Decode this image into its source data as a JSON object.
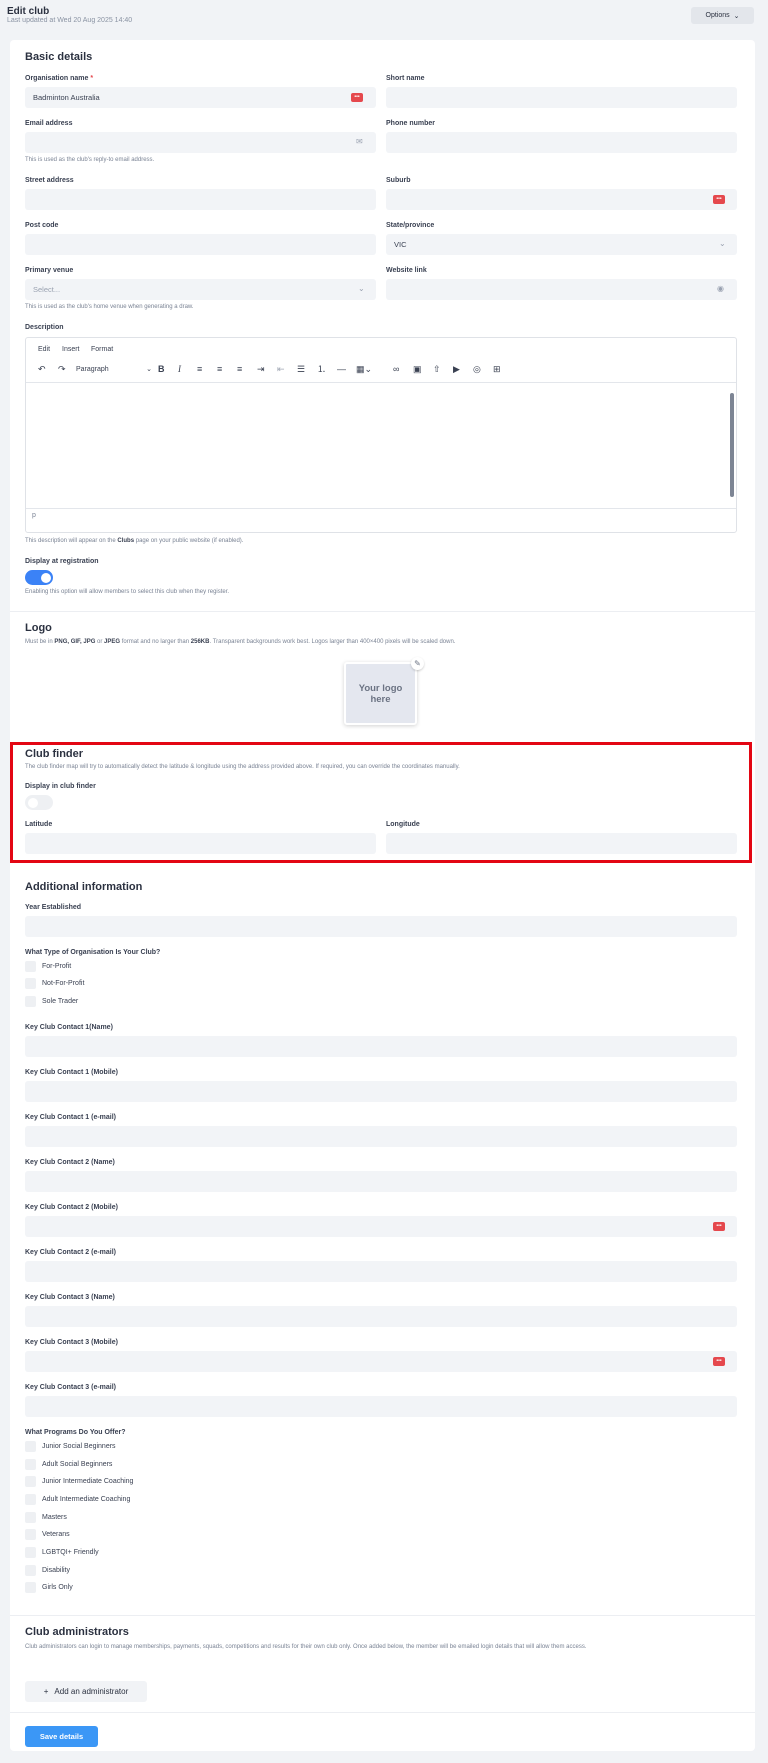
{
  "header": {
    "title": "Edit club",
    "last_updated": "Last updated at Wed 20 Aug 2025 14:40",
    "options_label": "Options"
  },
  "basic": {
    "title": "Basic details",
    "org_name_label": "Organisation name",
    "org_name_required": "*",
    "org_name_value": "Badminton Australia",
    "short_name_label": "Short name",
    "email_label": "Email address",
    "email_hint": "This is used as the club's reply-to email address.",
    "phone_label": "Phone number",
    "street_label": "Street address",
    "suburb_label": "Suburb",
    "postcode_label": "Post code",
    "state_label": "State/province",
    "state_value": "VIC",
    "venue_label": "Primary venue",
    "venue_placeholder": "Select...",
    "venue_hint": "This is used as the club's home venue when generating a draw.",
    "website_label": "Website link",
    "description_label": "Description",
    "description_hint_pre": "This description will appear on the ",
    "description_hint_bold": "Clubs",
    "description_hint_post": " page on your public website (if enabled).",
    "display_reg_label": "Display at registration",
    "display_reg_on": true,
    "display_reg_hint": "Enabling this option will allow members to select this club when they register."
  },
  "editor": {
    "menu": [
      "Edit",
      "Insert",
      "Format"
    ],
    "paragraph_label": "Paragraph",
    "status_path": "p"
  },
  "logo": {
    "title": "Logo",
    "hint_pre": "Must be in ",
    "hint_formats": "PNG, GIF, JPG",
    "hint_or": " or ",
    "hint_jpeg": "JPEG",
    "hint_mid": " format and no larger than ",
    "hint_size": "256KB",
    "hint_post": ". Transparent backgrounds work best. Logos larger than 400×400 pixels will be scaled down.",
    "placeholder_line1": "Your logo",
    "placeholder_line2": "here"
  },
  "club_finder": {
    "title": "Club finder",
    "hint": "The club finder map will try to automatically detect the latitude & longitude using the address provided above. If required, you can override the coordinates manually.",
    "display_label": "Display in club finder",
    "display_on": false,
    "latitude_label": "Latitude",
    "longitude_label": "Longitude"
  },
  "additional": {
    "title": "Additional information",
    "year_label": "Year Established",
    "org_type_label": "What Type of Organisation Is Your Club?",
    "org_types": [
      "For-Profit",
      "Not-For-Profit",
      "Sole Trader"
    ],
    "contacts": [
      "Key Club Contact 1(Name)",
      "Key Club Contact 1 (Mobile)",
      "Key Club Contact 1 (e-mail)",
      "Key Club Contact 2 (Name)",
      "Key Club Contact 2 (Mobile)",
      "Key Club Contact 2 (e-mail)",
      "Key Club Contact 3 (Name)",
      "Key Club Contact 3 (Mobile)",
      "Key Club Contact 3 (e-mail)"
    ],
    "programs_label": "What Programs Do You Offer?",
    "programs": [
      "Junior Social Beginners",
      "Adult Social Beginners",
      "Junior Intermediate Coaching",
      "Adult Intermediate Coaching",
      "Masters",
      "Veterans",
      "LGBTQI+ Friendly",
      "Disability",
      "Girls Only"
    ]
  },
  "admins": {
    "title": "Club administrators",
    "hint": "Club administrators can login to manage memberships, payments, squads, competitions and results for their own club only. Once added below, the member will be emailed login details that will allow them access.",
    "add_label": "Add an administrator"
  },
  "footer": {
    "save_label": "Save details"
  },
  "colors": {
    "accent": "#3b82f6",
    "save": "#3b97f6",
    "highlight": "#e30613",
    "password_icon": "#e5484d"
  }
}
